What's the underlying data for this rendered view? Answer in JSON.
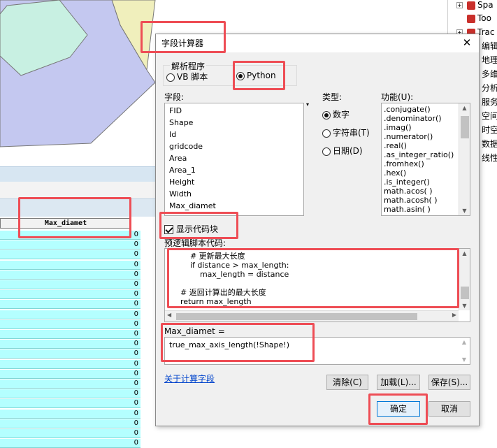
{
  "background": {
    "tree_items": [
      {
        "label": "Spa",
        "icon": "toolbox-icon"
      },
      {
        "label": "Too",
        "icon": "toolbox-icon"
      },
      {
        "label": "Trac",
        "icon": "toolbox-icon"
      }
    ],
    "menu_items": [
      "编辑",
      "地理",
      "多维",
      "分析",
      "服务",
      "空间",
      "时空",
      "数据",
      "线性"
    ],
    "table": {
      "column_header": "Max_diamet",
      "values": [
        "0",
        "0",
        "0",
        "0",
        "0",
        "0",
        "0",
        "0",
        "0",
        "0",
        "0",
        "0",
        "0",
        "0",
        "0",
        "0",
        "0",
        "0",
        "0",
        "0",
        "0",
        "0"
      ]
    },
    "map_colors": {
      "blue": "#c4c8f0",
      "yellow": "#f0efbc",
      "green": "#c8f0e2"
    }
  },
  "dialog": {
    "title": "字段计算器",
    "parser": {
      "label": "解析程序",
      "options": [
        {
          "label": "VB 脚本",
          "selected": false
        },
        {
          "label": "Python",
          "selected": true
        }
      ]
    },
    "fields": {
      "label": "字段:",
      "items": [
        "FID",
        "Shape",
        "Id",
        "gridcode",
        "Area",
        "Area_1",
        "Height",
        "Width",
        "Max_diamet"
      ]
    },
    "type": {
      "label": "类型:",
      "options": [
        {
          "label": "数字",
          "selected": true
        },
        {
          "label": "字符串(T)",
          "selected": false
        },
        {
          "label": "日期(D)",
          "selected": false
        }
      ]
    },
    "functions": {
      "label": "功能(U):",
      "items": [
        ".conjugate()",
        ".denominator()",
        ".imag()",
        ".numerator()",
        ".real()",
        ".as_integer_ratio()",
        ".fromhex()",
        ".hex()",
        ".is_integer()",
        "math.acos( )",
        "math.acosh( )",
        "math.asin( )"
      ]
    },
    "show_codeblock": {
      "label": "显示代码块",
      "checked": true
    },
    "operators": [
      "*",
      "/",
      "&",
      "+",
      "-",
      "="
    ],
    "prelogic": {
      "label": "预逻辑脚本代码:",
      "lines": [
        "        # 更新最大长度",
        "        if distance > max_length:",
        "            max_length = distance",
        "",
        "    # 返回计算出的最大长度",
        "    return max_length"
      ]
    },
    "expression": {
      "label": "Max_diamet =",
      "value": "true_max_axis_length(!Shape!)"
    },
    "about_link": "关于计算字段",
    "buttons": {
      "clear": "清除(C)",
      "load": "加载(L)...",
      "save": "保存(S)...",
      "ok": "确定",
      "cancel": "取消"
    },
    "close_glyph": "✕",
    "highlight_color": "#ee4d55"
  }
}
